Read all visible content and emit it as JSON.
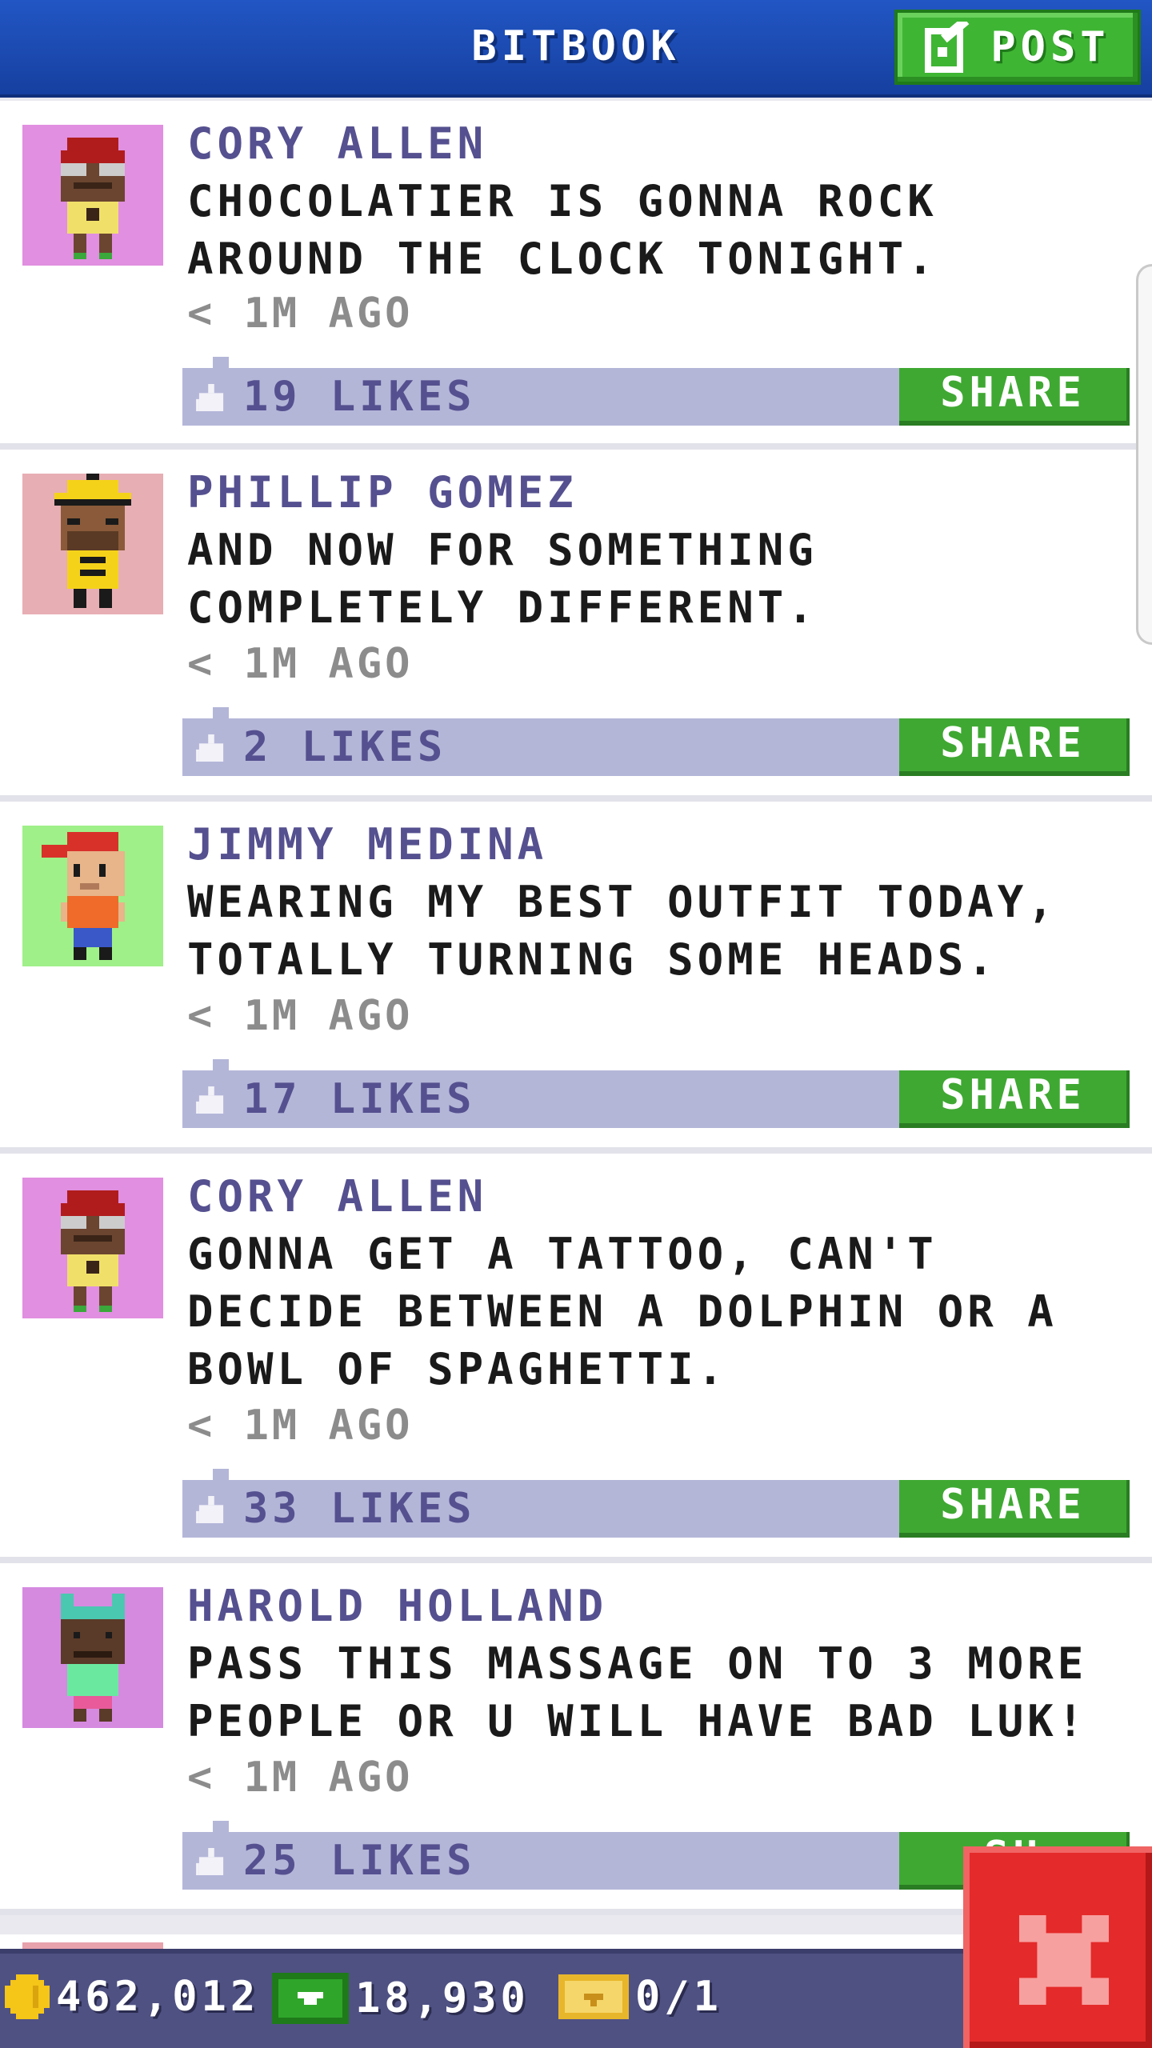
{
  "header": {
    "title": "BITBOOK",
    "post_label": "POST",
    "post_icon": "edit-icon"
  },
  "posts": [
    {
      "name": "CORY ALLEN",
      "text": "CHOCOLATIER IS GONNA ROCK AROUND THE CLOCK TONIGHT.",
      "time": "< 1M AGO",
      "likes": "19 LIKES",
      "share_label": "SHARE",
      "avatar_bg": "#e18fe0"
    },
    {
      "name": "PHILLIP GOMEZ",
      "text": "AND NOW FOR SOMETHING COMPLETELY DIFFERENT.",
      "time": "< 1M AGO",
      "likes": "2 LIKES",
      "share_label": "SHARE",
      "avatar_bg": "#e7aeb3"
    },
    {
      "name": "JIMMY MEDINA",
      "text": "WEARING MY BEST OUTFIT TODAY, TOTALLY TURNING SOME HEADS.",
      "time": "< 1M AGO",
      "likes": "17 LIKES",
      "share_label": "SHARE",
      "avatar_bg": "#9ff088"
    },
    {
      "name": "CORY ALLEN",
      "text": "GONNA GET A TATTOO, CAN'T DECIDE BETWEEN A DOLPHIN OR A BOWL OF SPAGHETTI.",
      "time": "< 1M AGO",
      "likes": "33 LIKES",
      "share_label": "SHARE",
      "avatar_bg": "#e18fe0"
    },
    {
      "name": "HAROLD HOLLAND",
      "text": "PASS THIS MASSAGE ON TO 3 MORE PEOPLE OR U WILL HAVE BAD LUK!",
      "time": "< 1M AGO",
      "likes": "25 LIKES",
      "share_label": "SH",
      "avatar_bg": "#d58ae0"
    }
  ],
  "bottom_bar": {
    "coins": "462,012",
    "bux": "18,930",
    "tickets": "0/1",
    "coin_color": "#f5c518",
    "bux_color": "#2fa62a",
    "ticket_color": "#e8b62a"
  },
  "close_button": {
    "icon": "close-icon",
    "color": "#e42a2a"
  }
}
